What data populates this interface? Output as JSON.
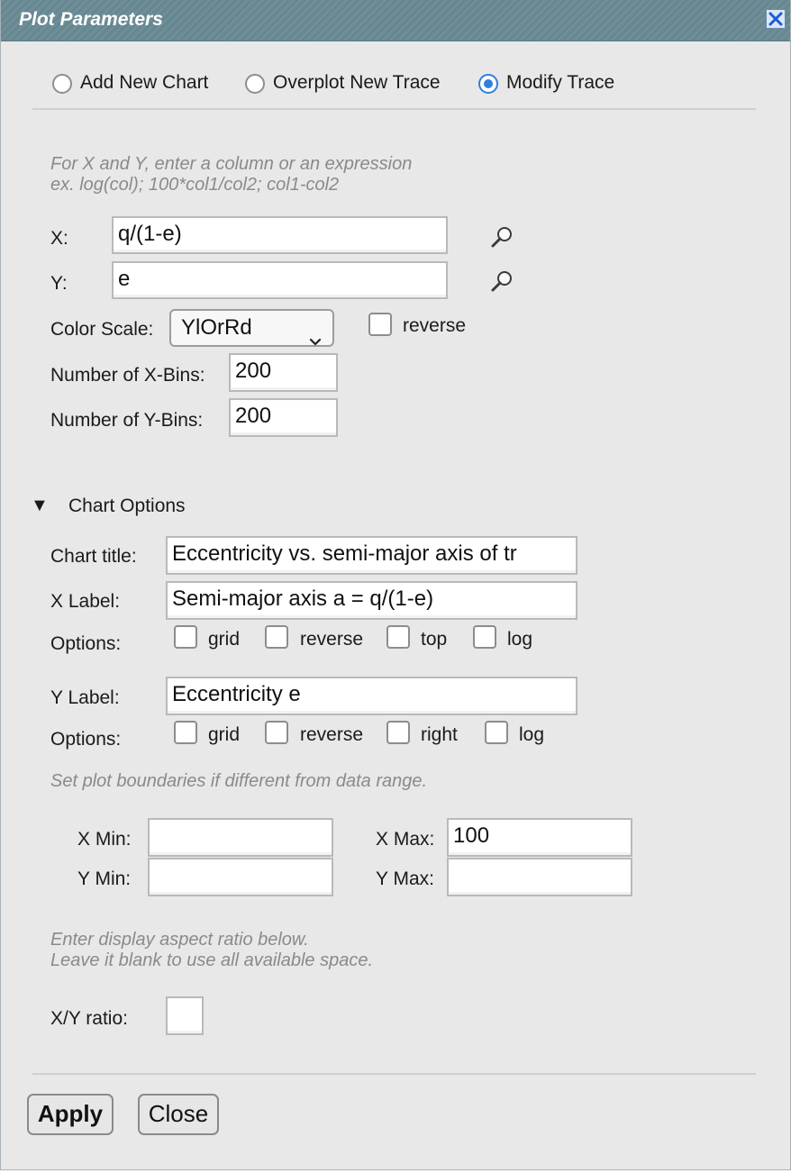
{
  "dialog": {
    "title": "Plot Parameters"
  },
  "mode": {
    "options": [
      "Add New Chart",
      "Overplot New Trace",
      "Modify Trace"
    ],
    "selected": "Modify Trace"
  },
  "hint_xy": [
    "For X and Y, enter a column or an expression",
    "ex. log(col); 100*col1/col2; col1-col2"
  ],
  "fields": {
    "x_label": "X:",
    "x_value": "q/(1-e)",
    "y_label": "Y:",
    "y_value": "e",
    "color_scale_label": "Color Scale:",
    "color_scale_value": "YlOrRd",
    "reverse_label": "reverse",
    "xbins_label": "Number of X-Bins:",
    "xbins_value": "200",
    "ybins_label": "Number of Y-Bins:",
    "ybins_value": "200"
  },
  "chart_options": {
    "toggle_icon": "▼",
    "heading": "Chart Options",
    "title_label": "Chart title:",
    "title_value": "Eccentricity vs. semi-major axis of tr",
    "xlabel_label": "X Label:",
    "xlabel_value": "Semi-major axis a = q/(1-e)",
    "x_options_label": "Options:",
    "x_options": [
      "grid",
      "reverse",
      "top",
      "log"
    ],
    "ylabel_label": "Y Label:",
    "ylabel_value": "Eccentricity e",
    "y_options_label": "Options:",
    "y_options": [
      "grid",
      "reverse",
      "right",
      "log"
    ]
  },
  "bounds": {
    "hint": "Set plot boundaries if different from data range.",
    "xmin_label": "X Min:",
    "xmin_value": "",
    "xmax_label": "X Max:",
    "xmax_value": "100",
    "ymin_label": "Y Min:",
    "ymin_value": "",
    "ymax_label": "Y Max:",
    "ymax_value": ""
  },
  "aspect": {
    "hint": [
      "Enter display aspect ratio below.",
      "Leave it blank to use all available space."
    ],
    "ratio_label": "X/Y ratio:",
    "ratio_value": ""
  },
  "buttons": {
    "apply": "Apply",
    "close": "Close"
  },
  "icons": {
    "close": "close-icon",
    "lookup": "magnifier-icon",
    "dropdown": "chevron-down-icon"
  },
  "colors": {
    "title_bar": "#6e8f98",
    "radio_selected": "#2f7fe0",
    "close_icon": "#1f5bd1"
  }
}
